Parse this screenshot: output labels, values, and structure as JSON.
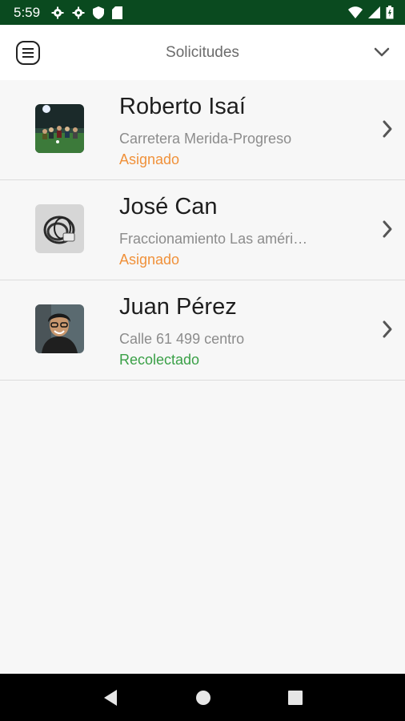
{
  "status_bar": {
    "time": "5:59",
    "icons": [
      "settings-icon",
      "settings-icon",
      "shield-icon",
      "sd-card-icon",
      "wifi-icon",
      "signal-icon",
      "battery-icon"
    ]
  },
  "header": {
    "title": "Solicitudes",
    "menu_icon": "menu-icon",
    "dropdown_icon": "chevron-down-icon"
  },
  "requests": [
    {
      "name": "Roberto Isaí",
      "address": "Carretera Merida-Progreso",
      "status": "Asignado",
      "status_color": "#f0913a"
    },
    {
      "name": "José Can",
      "address": "Fraccionamiento Las américas",
      "status": "Asignado",
      "status_color": "#f0913a"
    },
    {
      "name": "Juan Pérez",
      "address": "Calle 61 499 centro",
      "status": "Recolectado",
      "status_color": "#3aa047"
    }
  ],
  "colors": {
    "status_bar": "#0a4a1f",
    "assigned": "#f0913a",
    "collected": "#3aa047"
  },
  "nav_bar": {
    "icons": [
      "back-icon",
      "home-icon",
      "recents-icon"
    ]
  }
}
